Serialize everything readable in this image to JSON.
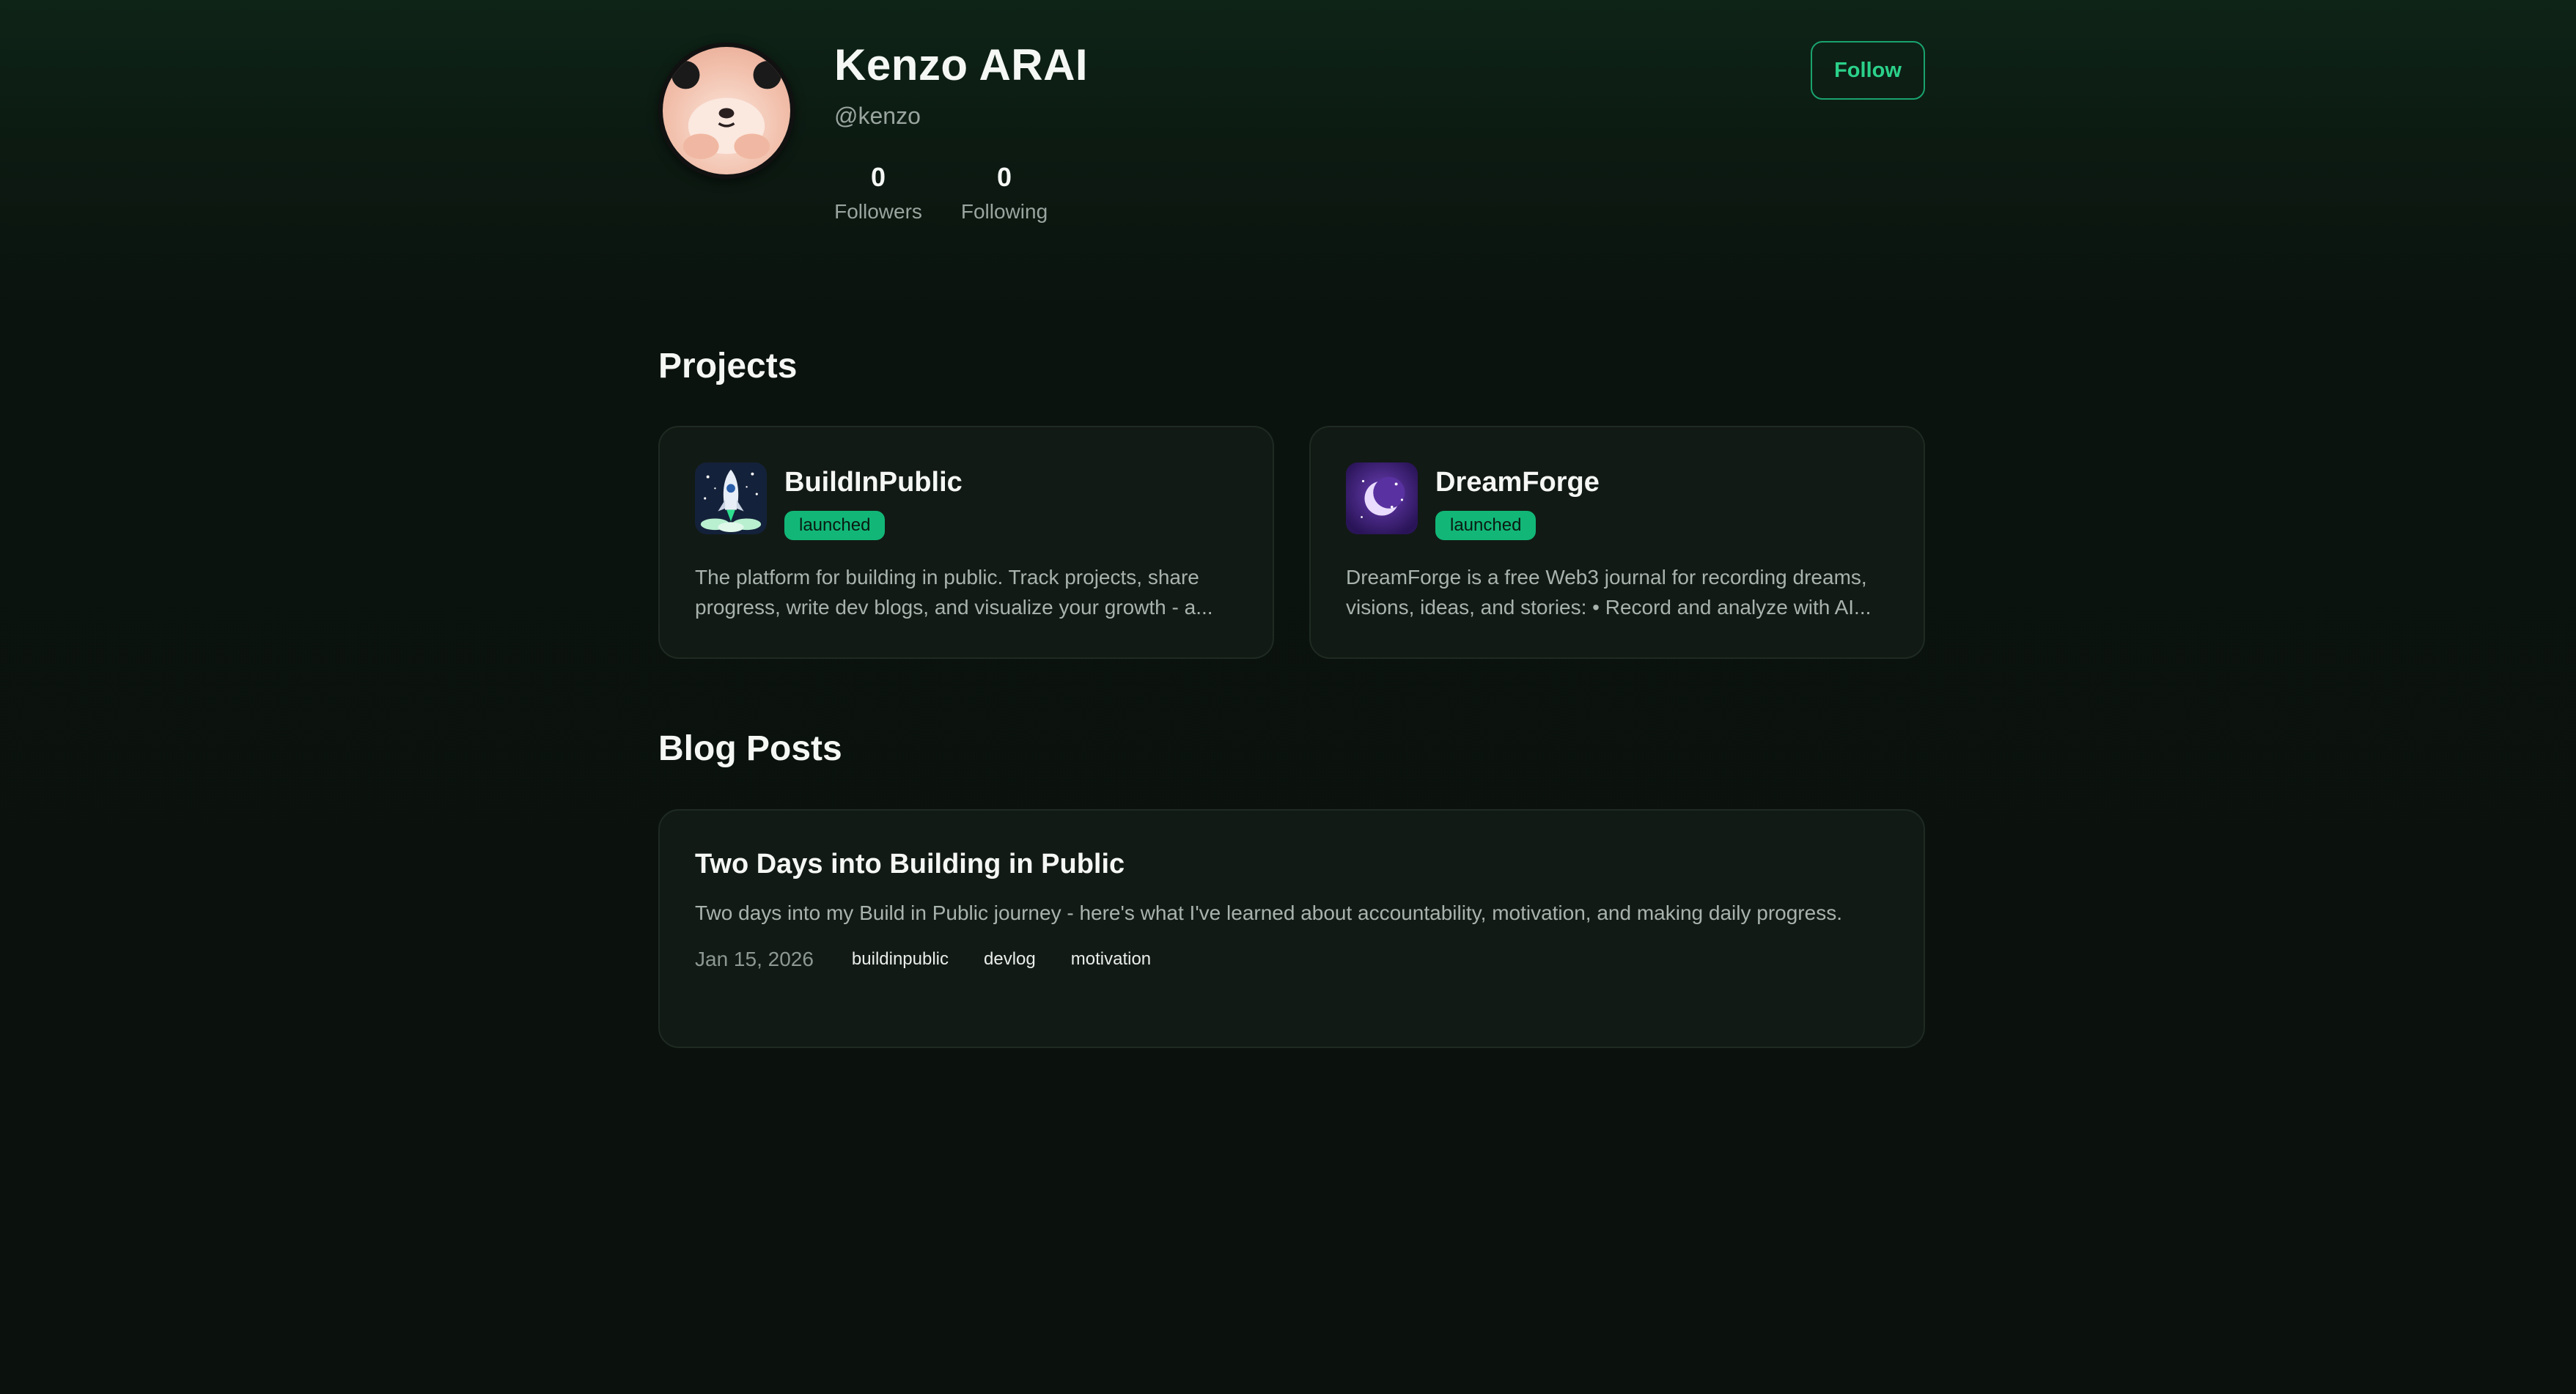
{
  "profile": {
    "name": "Kenzo ARAI",
    "handle": "@kenzo",
    "followers_count": "0",
    "followers_label": "Followers",
    "following_count": "0",
    "following_label": "Following",
    "follow_label": "Follow"
  },
  "projects": {
    "title": "Projects",
    "items": [
      {
        "name": "BuildInPublic",
        "status": "launched",
        "description": "The platform for building in public. Track projects, share progress, write dev blogs, and visualize your growth - a...",
        "icon": "rocket-icon"
      },
      {
        "name": "DreamForge",
        "status": "launched",
        "description": "DreamForge is a free Web3 journal for recording dreams, visions, ideas, and stories: • Record and analyze with AI...",
        "icon": "moon-icon"
      }
    ]
  },
  "blog": {
    "title": "Blog Posts",
    "posts": [
      {
        "title": "Two Days into Building in Public",
        "excerpt": "Two days into my Build in Public journey - here's what I've learned about accountability, motivation, and making daily progress.",
        "date": "Jan 15, 2026",
        "tags": [
          "buildinpublic",
          "devlog",
          "motivation"
        ]
      }
    ]
  },
  "colors": {
    "accent": "#12b777",
    "follow_text": "#2bd18a",
    "background": "#0b120e",
    "card": "#121a15"
  }
}
